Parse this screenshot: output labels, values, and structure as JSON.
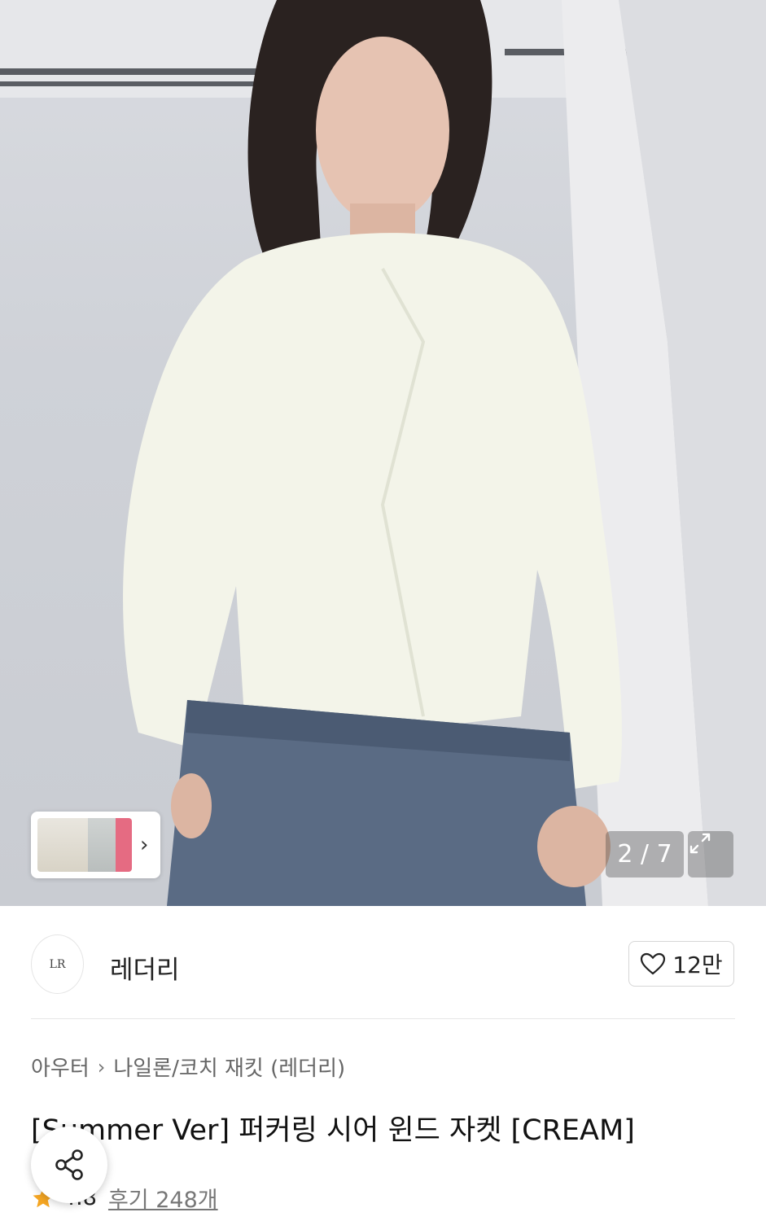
{
  "gallery": {
    "counter": "2 / 7",
    "next_arrow": "›",
    "icons": {
      "expand": "expand-icon",
      "next": "chevron-right-icon"
    }
  },
  "seller": {
    "name": "레더리",
    "logo_text": "LR",
    "likes": "12만",
    "icons": {
      "like": "heart-outline-icon"
    }
  },
  "breadcrumb": {
    "items": [
      "아우터",
      "나일론/코치 재킷 (레더리)"
    ],
    "separator": "›"
  },
  "product": {
    "title": "[Summer Ver] 퍼커링 시어 윈드 자켓 [CREAM]"
  },
  "rating": {
    "score": "4.8",
    "reviews": "후기 248개",
    "star_color": "#f5a623",
    "icons": {
      "star": "star-icon"
    }
  },
  "share": {
    "icon": "share-icon"
  }
}
